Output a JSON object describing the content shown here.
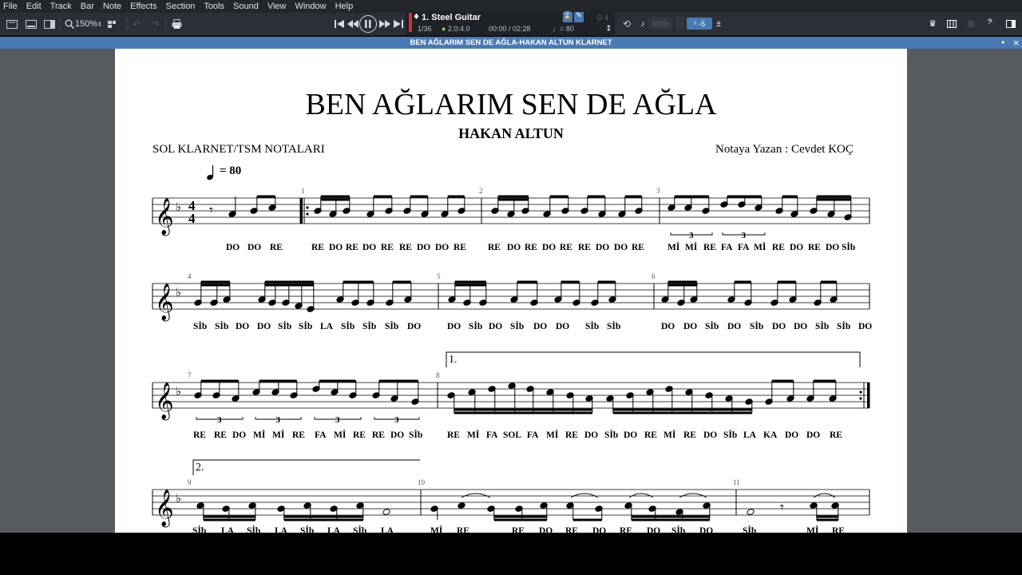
{
  "menu": [
    "File",
    "Edit",
    "Track",
    "Bar",
    "Note",
    "Effects",
    "Section",
    "Tools",
    "Sound",
    "View",
    "Window",
    "Help"
  ],
  "toolbar": {
    "zoom": "150%",
    "track_name": "1. Steel Guitar",
    "bar_position": "1/36",
    "time_signature": "2.0:4.0",
    "time_position": "00:00 / 02:28",
    "tempo": "♩= 80",
    "volume": "100%",
    "transpose": "-5",
    "key": "D 4",
    "accent_color": "#4a7ab4"
  },
  "score": {
    "tab_title": "BEN AĞLARIM SEN DE AĞLA-HAKAN ALTUN KLARNET",
    "title": "BEN AĞLARIM SEN DE AĞLA",
    "subtitle": "HAKAN ALTUN",
    "instrument": "SOL KLARNET/TSM  NOTALARI",
    "author": "Notaya Yazan : Cevdet KOÇ",
    "tempo_text": "= 80",
    "time_sig_top": "4",
    "time_sig_bottom": "4",
    "volta1": "1.",
    "volta2": "2.",
    "bar_numbers": [
      "1",
      "2",
      "3",
      "4",
      "5",
      "6",
      "7",
      "8",
      "9",
      "10",
      "11"
    ],
    "tuplet": "3",
    "lyrics": [
      [
        "DO",
        "DO",
        "RE",
        "RE",
        "DO",
        "RE",
        "DO",
        "RE",
        "RE",
        "DO",
        "DO",
        "RE",
        "RE",
        "DO",
        "RE",
        "DO",
        "RE",
        "RE",
        "DO",
        "DO",
        "RE",
        "Mİ",
        "Mİ",
        "RE",
        "FA",
        "FA",
        "Mİ",
        "RE",
        "DO",
        "RE",
        "DO",
        "Sİb"
      ],
      [
        "Sİb",
        "Sİb",
        "DO",
        "DO",
        "Sİb",
        "Sİb",
        "LA",
        "Sİb",
        "Sİb",
        "Sİb",
        "DO",
        "DO",
        "Sİb",
        "DO",
        "Sİb",
        "DO",
        "DO",
        "Sİb",
        "Sİb",
        "DO",
        "DO",
        "Sİb",
        "DO",
        "Sİb",
        "DO",
        "DO",
        "Sİb",
        "Sİb",
        "DO"
      ],
      [
        "RE",
        "RE",
        "DO",
        "Mİ",
        "Mİ",
        "RE",
        "FA",
        "Mİ",
        "RE",
        "RE",
        "DO",
        "Sİb",
        "RE",
        "Mİ",
        "FA",
        "SOL",
        "FA",
        "Mİ",
        "RE",
        "DO",
        "Sİb",
        "DO",
        "RE",
        "Mİ",
        "RE",
        "DO",
        "Sİb",
        "LA",
        "KA",
        "DO",
        "DO",
        "RE"
      ],
      [
        "Sİb",
        "LA",
        "Sİb",
        "LA",
        "Sİb",
        "LA",
        "Sİb",
        "LA",
        "Mİ",
        "RE",
        "RE",
        "DO",
        "RE",
        "DO",
        "RE",
        "DO",
        "Sİb",
        "DO",
        "Sİb",
        "Mİ",
        "RE"
      ]
    ]
  }
}
